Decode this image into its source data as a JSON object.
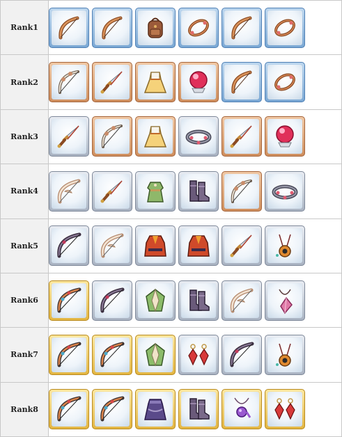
{
  "ranks": [
    {
      "label": "Rank1",
      "items": [
        {
          "icon": "bow-icon",
          "frame": "blue"
        },
        {
          "icon": "bow-icon",
          "frame": "blue"
        },
        {
          "icon": "backpack-icon",
          "frame": "blue"
        },
        {
          "icon": "bracelet-icon",
          "frame": "blue"
        },
        {
          "icon": "bow-icon",
          "frame": "blue"
        },
        {
          "icon": "bracelet-icon",
          "frame": "blue"
        }
      ]
    },
    {
      "label": "Rank2",
      "items": [
        {
          "icon": "ornate-bow-icon",
          "frame": "bronze"
        },
        {
          "icon": "dagger-icon",
          "frame": "bronze"
        },
        {
          "icon": "dress-icon",
          "frame": "bronze"
        },
        {
          "icon": "crystal-orb-icon",
          "frame": "bronze"
        },
        {
          "icon": "bow-icon",
          "frame": "blue"
        },
        {
          "icon": "bracelet-icon",
          "frame": "blue"
        }
      ]
    },
    {
      "label": "Rank3",
      "items": [
        {
          "icon": "dagger-icon",
          "frame": "silver"
        },
        {
          "icon": "ornate-bow-icon",
          "frame": "bronze"
        },
        {
          "icon": "dress-icon",
          "frame": "bronze"
        },
        {
          "icon": "gem-bracelet-icon",
          "frame": "silver"
        },
        {
          "icon": "dagger-icon",
          "frame": "bronze"
        },
        {
          "icon": "crystal-orb-icon",
          "frame": "bronze"
        }
      ]
    },
    {
      "label": "Rank4",
      "items": [
        {
          "icon": "winged-bow-icon",
          "frame": "silver"
        },
        {
          "icon": "dagger-icon",
          "frame": "silver"
        },
        {
          "icon": "tunic-icon",
          "frame": "silver"
        },
        {
          "icon": "boots-icon",
          "frame": "silver"
        },
        {
          "icon": "ornate-bow-icon",
          "frame": "bronze"
        },
        {
          "icon": "gem-bracelet-icon",
          "frame": "silver"
        }
      ]
    },
    {
      "label": "Rank5",
      "items": [
        {
          "icon": "dark-bow-icon",
          "frame": "silver"
        },
        {
          "icon": "winged-bow-icon",
          "frame": "silver"
        },
        {
          "icon": "robe-icon",
          "frame": "silver"
        },
        {
          "icon": "robe-icon",
          "frame": "silver"
        },
        {
          "icon": "dagger-icon",
          "frame": "silver"
        },
        {
          "icon": "amulet-icon",
          "frame": "silver"
        }
      ]
    },
    {
      "label": "Rank6",
      "items": [
        {
          "icon": "jeweled-bow-icon",
          "frame": "gold"
        },
        {
          "icon": "dark-bow-icon",
          "frame": "silver"
        },
        {
          "icon": "leaf-cloak-icon",
          "frame": "silver"
        },
        {
          "icon": "boots-icon",
          "frame": "silver"
        },
        {
          "icon": "winged-bow-icon",
          "frame": "silver"
        },
        {
          "icon": "crystal-pendant-icon",
          "frame": "silver"
        }
      ]
    },
    {
      "label": "Rank7",
      "items": [
        {
          "icon": "jeweled-bow-icon",
          "frame": "gold"
        },
        {
          "icon": "jeweled-bow-icon",
          "frame": "gold"
        },
        {
          "icon": "leaf-cloak-icon",
          "frame": "gold"
        },
        {
          "icon": "earrings-icon",
          "frame": "silver"
        },
        {
          "icon": "dark-bow-icon",
          "frame": "silver"
        },
        {
          "icon": "amulet-icon",
          "frame": "silver"
        }
      ]
    },
    {
      "label": "Rank8",
      "items": [
        {
          "icon": "jeweled-bow-icon",
          "frame": "gold"
        },
        {
          "icon": "jeweled-bow-icon",
          "frame": "gold"
        },
        {
          "icon": "skirt-icon",
          "frame": "gold"
        },
        {
          "icon": "boots-icon",
          "frame": "gold"
        },
        {
          "icon": "gem-pendant-icon",
          "frame": "gold"
        },
        {
          "icon": "earrings-icon",
          "frame": "gold"
        }
      ]
    }
  ]
}
